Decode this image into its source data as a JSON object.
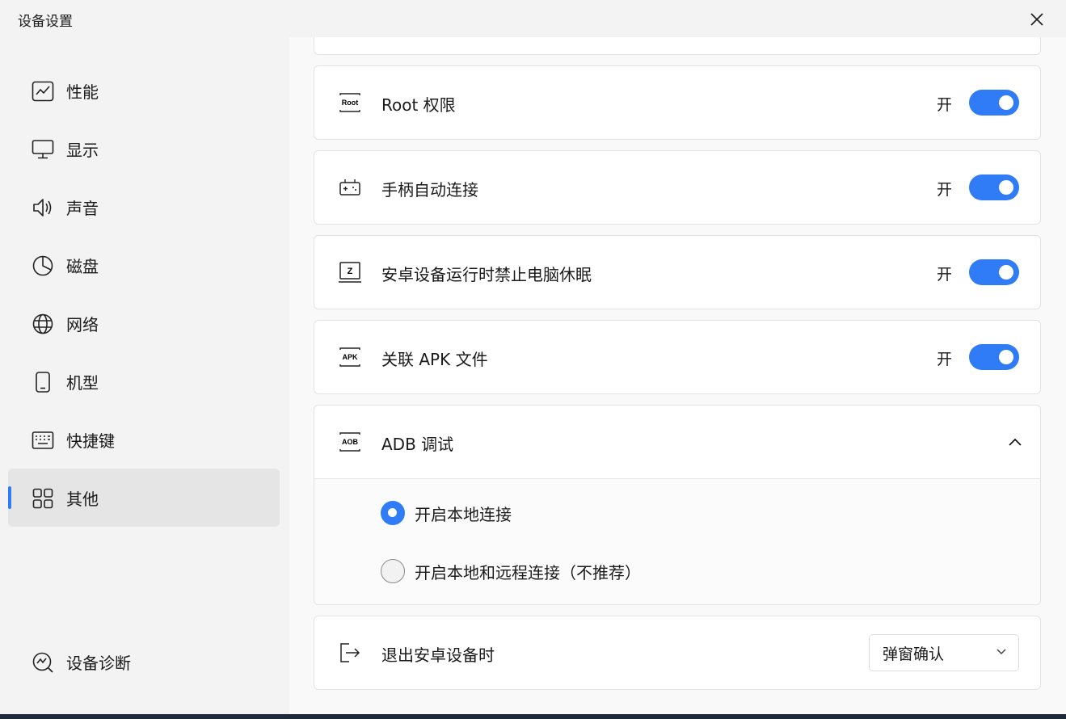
{
  "window": {
    "title": "设备设置"
  },
  "sidebar": {
    "items": [
      {
        "label": "性能",
        "icon": "performance-chart-icon"
      },
      {
        "label": "显示",
        "icon": "monitor-icon"
      },
      {
        "label": "声音",
        "icon": "speaker-icon"
      },
      {
        "label": "磁盘",
        "icon": "pie-chart-icon"
      },
      {
        "label": "网络",
        "icon": "globe-icon"
      },
      {
        "label": "机型",
        "icon": "phone-icon"
      },
      {
        "label": "快捷键",
        "icon": "keyboard-icon"
      },
      {
        "label": "其他",
        "icon": "grid-icon",
        "active": true
      }
    ],
    "diagnostics_label": "设备诊断"
  },
  "settings": {
    "root": {
      "label": "Root 权限",
      "state": "开",
      "icon_text": "Root",
      "on": true
    },
    "gamepad": {
      "label": "手柄自动连接",
      "state": "开",
      "on": true
    },
    "no_sleep": {
      "label": "安卓设备运行时禁止电脑休眠",
      "state": "开",
      "icon_text": "Z",
      "on": true
    },
    "apk": {
      "label": "关联 APK 文件",
      "state": "开",
      "icon_text": "APK",
      "on": true
    },
    "adb": {
      "label": "ADB 调试",
      "icon_text": "AOB",
      "expanded": true,
      "options": [
        {
          "label": "开启本地连接",
          "selected": true
        },
        {
          "label": "开启本地和远程连接（不推荐）",
          "selected": false
        }
      ]
    },
    "exit": {
      "label": "退出安卓设备时",
      "value": "弹窗确认"
    }
  },
  "colors": {
    "accent": "#2f7cf6",
    "sidebar_bg": "#f3f3f3",
    "content_bg": "#f9f9f9"
  }
}
